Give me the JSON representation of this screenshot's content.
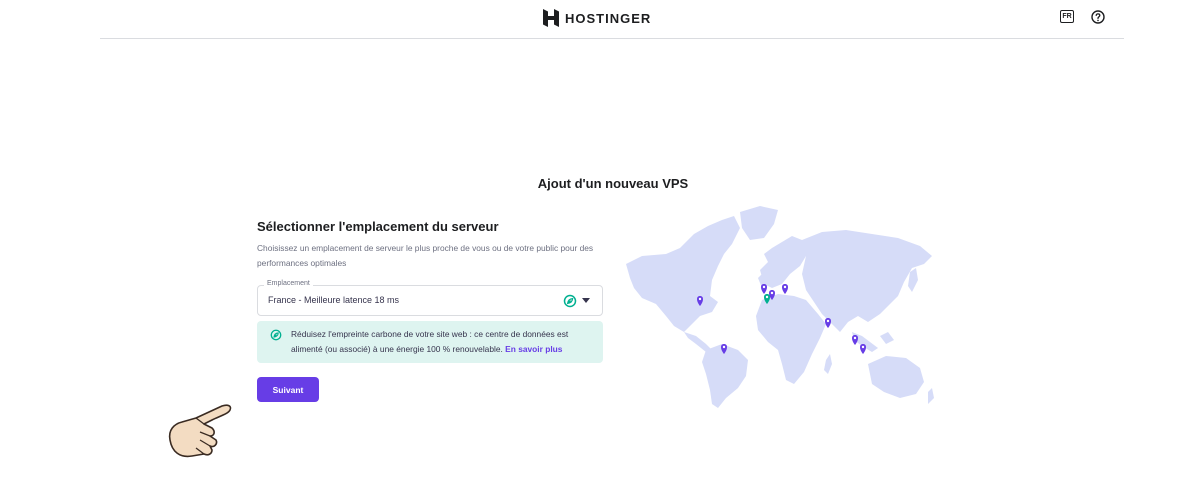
{
  "header": {
    "brand": "HOSTINGER",
    "lang_label": "FR",
    "logo_icon": "hostinger-logo-icon",
    "help_icon": "help-circle-icon"
  },
  "main": {
    "page_title": "Ajout d'un nouveau VPS",
    "section_title": "Sélectionner l'emplacement du serveur",
    "description": "Choisissez un emplacement de serveur le plus proche de vous ou de votre public pour des performances optimales",
    "location_select": {
      "label": "Emplacement",
      "value": "France - Meilleure latence 18 ms",
      "eco_icon": "leaf-icon",
      "caret_icon": "chevron-down-icon"
    },
    "eco_notice": {
      "text": "Réduisez l'empreinte carbone de votre site web : ce centre de données est alimenté (ou associé) à une énergie 100 % renouvelable.",
      "link": "En savoir plus",
      "icon": "leaf-icon"
    },
    "next_button": "Suivant"
  },
  "map": {
    "land_color": "#d6dcf8",
    "pin_color": "#673de6",
    "selected_pin_color": "#00b090",
    "pins": [
      "usa",
      "brazil",
      "uk",
      "netherlands",
      "lithuania",
      "france",
      "india",
      "malaysia",
      "indonesia"
    ],
    "selected": "france"
  },
  "colors": {
    "primary": "#673de6",
    "eco_bg": "#def4f0"
  }
}
